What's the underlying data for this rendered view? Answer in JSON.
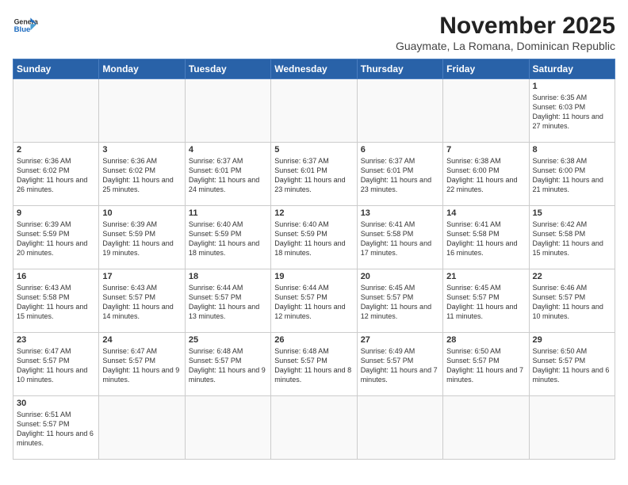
{
  "header": {
    "logo_general": "General",
    "logo_blue": "Blue",
    "month_title": "November 2025",
    "subtitle": "Guaymate, La Romana, Dominican Republic"
  },
  "weekdays": [
    "Sunday",
    "Monday",
    "Tuesday",
    "Wednesday",
    "Thursday",
    "Friday",
    "Saturday"
  ],
  "days": [
    {
      "num": "",
      "sunrise": "",
      "sunset": "",
      "daylight": ""
    },
    {
      "num": "",
      "sunrise": "",
      "sunset": "",
      "daylight": ""
    },
    {
      "num": "",
      "sunrise": "",
      "sunset": "",
      "daylight": ""
    },
    {
      "num": "",
      "sunrise": "",
      "sunset": "",
      "daylight": ""
    },
    {
      "num": "",
      "sunrise": "",
      "sunset": "",
      "daylight": ""
    },
    {
      "num": "",
      "sunrise": "",
      "sunset": "",
      "daylight": ""
    },
    {
      "num": "1",
      "sunrise": "6:35 AM",
      "sunset": "6:03 PM",
      "daylight": "11 hours and 27 minutes."
    },
    {
      "num": "2",
      "sunrise": "6:36 AM",
      "sunset": "6:02 PM",
      "daylight": "11 hours and 26 minutes."
    },
    {
      "num": "3",
      "sunrise": "6:36 AM",
      "sunset": "6:02 PM",
      "daylight": "11 hours and 25 minutes."
    },
    {
      "num": "4",
      "sunrise": "6:37 AM",
      "sunset": "6:01 PM",
      "daylight": "11 hours and 24 minutes."
    },
    {
      "num": "5",
      "sunrise": "6:37 AM",
      "sunset": "6:01 PM",
      "daylight": "11 hours and 23 minutes."
    },
    {
      "num": "6",
      "sunrise": "6:37 AM",
      "sunset": "6:01 PM",
      "daylight": "11 hours and 23 minutes."
    },
    {
      "num": "7",
      "sunrise": "6:38 AM",
      "sunset": "6:00 PM",
      "daylight": "11 hours and 22 minutes."
    },
    {
      "num": "8",
      "sunrise": "6:38 AM",
      "sunset": "6:00 PM",
      "daylight": "11 hours and 21 minutes."
    },
    {
      "num": "9",
      "sunrise": "6:39 AM",
      "sunset": "5:59 PM",
      "daylight": "11 hours and 20 minutes."
    },
    {
      "num": "10",
      "sunrise": "6:39 AM",
      "sunset": "5:59 PM",
      "daylight": "11 hours and 19 minutes."
    },
    {
      "num": "11",
      "sunrise": "6:40 AM",
      "sunset": "5:59 PM",
      "daylight": "11 hours and 18 minutes."
    },
    {
      "num": "12",
      "sunrise": "6:40 AM",
      "sunset": "5:59 PM",
      "daylight": "11 hours and 18 minutes."
    },
    {
      "num": "13",
      "sunrise": "6:41 AM",
      "sunset": "5:58 PM",
      "daylight": "11 hours and 17 minutes."
    },
    {
      "num": "14",
      "sunrise": "6:41 AM",
      "sunset": "5:58 PM",
      "daylight": "11 hours and 16 minutes."
    },
    {
      "num": "15",
      "sunrise": "6:42 AM",
      "sunset": "5:58 PM",
      "daylight": "11 hours and 15 minutes."
    },
    {
      "num": "16",
      "sunrise": "6:43 AM",
      "sunset": "5:58 PM",
      "daylight": "11 hours and 15 minutes."
    },
    {
      "num": "17",
      "sunrise": "6:43 AM",
      "sunset": "5:57 PM",
      "daylight": "11 hours and 14 minutes."
    },
    {
      "num": "18",
      "sunrise": "6:44 AM",
      "sunset": "5:57 PM",
      "daylight": "11 hours and 13 minutes."
    },
    {
      "num": "19",
      "sunrise": "6:44 AM",
      "sunset": "5:57 PM",
      "daylight": "11 hours and 12 minutes."
    },
    {
      "num": "20",
      "sunrise": "6:45 AM",
      "sunset": "5:57 PM",
      "daylight": "11 hours and 12 minutes."
    },
    {
      "num": "21",
      "sunrise": "6:45 AM",
      "sunset": "5:57 PM",
      "daylight": "11 hours and 11 minutes."
    },
    {
      "num": "22",
      "sunrise": "6:46 AM",
      "sunset": "5:57 PM",
      "daylight": "11 hours and 10 minutes."
    },
    {
      "num": "23",
      "sunrise": "6:47 AM",
      "sunset": "5:57 PM",
      "daylight": "11 hours and 10 minutes."
    },
    {
      "num": "24",
      "sunrise": "6:47 AM",
      "sunset": "5:57 PM",
      "daylight": "11 hours and 9 minutes."
    },
    {
      "num": "25",
      "sunrise": "6:48 AM",
      "sunset": "5:57 PM",
      "daylight": "11 hours and 9 minutes."
    },
    {
      "num": "26",
      "sunrise": "6:48 AM",
      "sunset": "5:57 PM",
      "daylight": "11 hours and 8 minutes."
    },
    {
      "num": "27",
      "sunrise": "6:49 AM",
      "sunset": "5:57 PM",
      "daylight": "11 hours and 7 minutes."
    },
    {
      "num": "28",
      "sunrise": "6:50 AM",
      "sunset": "5:57 PM",
      "daylight": "11 hours and 7 minutes."
    },
    {
      "num": "29",
      "sunrise": "6:50 AM",
      "sunset": "5:57 PM",
      "daylight": "11 hours and 6 minutes."
    },
    {
      "num": "30",
      "sunrise": "6:51 AM",
      "sunset": "5:57 PM",
      "daylight": "11 hours and 6 minutes."
    },
    {
      "num": "",
      "sunrise": "",
      "sunset": "",
      "daylight": ""
    },
    {
      "num": "",
      "sunrise": "",
      "sunset": "",
      "daylight": ""
    },
    {
      "num": "",
      "sunrise": "",
      "sunset": "",
      "daylight": ""
    },
    {
      "num": "",
      "sunrise": "",
      "sunset": "",
      "daylight": ""
    },
    {
      "num": "",
      "sunrise": "",
      "sunset": "",
      "daylight": ""
    },
    {
      "num": "",
      "sunrise": "",
      "sunset": "",
      "daylight": ""
    }
  ],
  "labels": {
    "sunrise_prefix": "Sunrise: ",
    "sunset_prefix": "Sunset: ",
    "daylight_prefix": "Daylight: "
  }
}
